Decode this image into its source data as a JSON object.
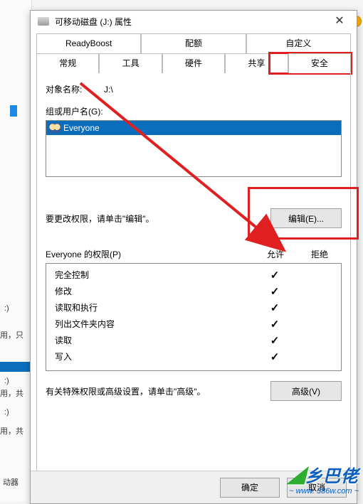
{
  "dialog": {
    "title": "可移动磁盘 (J:) 属性"
  },
  "tabs": {
    "row1": [
      "ReadyBoost",
      "配额",
      "自定义"
    ],
    "row2": [
      "常规",
      "工具",
      "硬件",
      "共享",
      "安全"
    ],
    "active": "安全"
  },
  "object_label": "对象名称:",
  "object_value": "J:\\",
  "groups_label": "组或用户名(G):",
  "groups": {
    "items": [
      "Everyone"
    ]
  },
  "edit_hint": "要更改权限，请单击\"编辑\"。",
  "edit_btn": "编辑(E)...",
  "perm_label": "Everyone 的权限(P)",
  "perm_cols": {
    "allow": "允许",
    "deny": "拒绝"
  },
  "permissions": [
    {
      "name": "完全控制",
      "allow": true,
      "deny": false
    },
    {
      "name": "修改",
      "allow": true,
      "deny": false
    },
    {
      "name": "读取和执行",
      "allow": true,
      "deny": false
    },
    {
      "name": "列出文件夹内容",
      "allow": true,
      "deny": false
    },
    {
      "name": "读取",
      "allow": true,
      "deny": false
    },
    {
      "name": "写入",
      "allow": true,
      "deny": false
    }
  ],
  "advanced_hint": "有关特殊权限或高级设置，请单击\"高级\"。",
  "advanced_btn": "高级(V)",
  "buttons": {
    "ok": "确定",
    "cancel": "取消"
  },
  "watermark": {
    "brand": "乡巴佬",
    "url": "~ www. 386w.com ~"
  },
  "bg": {
    "t1": ":)",
    "t2": "用，只",
    "t3": ":)",
    "t4": "用，共",
    "t5": ":)",
    "t6": "用，共",
    "t7": "动器"
  }
}
